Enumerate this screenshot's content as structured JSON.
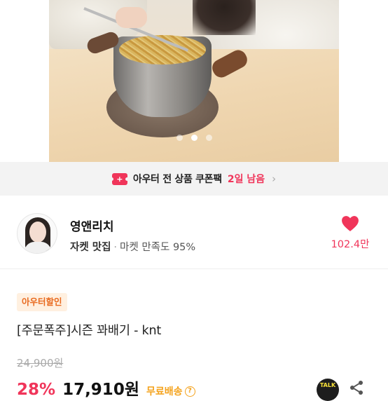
{
  "gallery": {
    "image_alt": "product photo",
    "dots": [
      false,
      true,
      false
    ]
  },
  "coupon_banner": {
    "icon": "coupon-ticket-icon",
    "text": "아우터 전 상품 쿠폰팩",
    "highlight": "2일 남음",
    "chevron": "›"
  },
  "seller": {
    "name": "영앤리치",
    "category": "자켓 맛집",
    "separator": "·",
    "satisfaction": "마켓 만족도 95%",
    "likes": "102.4만",
    "accent_color": "#f0355a"
  },
  "product": {
    "badge": "아우터할인",
    "title": "[주문폭주]시즌 꽈배기 - knt",
    "original_price": "24,900원",
    "discount": "28%",
    "price": "17,910원",
    "shipping": "무료배송",
    "shipping_info_icon": "?",
    "talk_label": "TALK"
  }
}
